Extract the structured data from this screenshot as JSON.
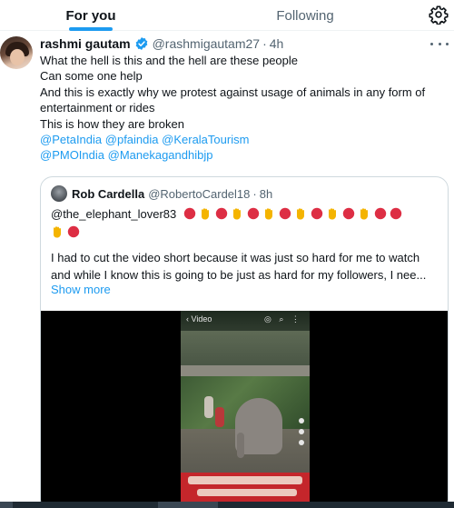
{
  "tabs": {
    "for_you": "For you",
    "following": "Following"
  },
  "tweet": {
    "display_name": "rashmi gautam",
    "handle": "@rashmigautam27",
    "separator": "·",
    "time": "4h",
    "lines": [
      "What the hell is this and the hell are these people",
      "Can some one help",
      "And this is exactly why we protest against usage of animals in any form of",
      "entertainment or rides",
      "This is how they are broken"
    ],
    "mentions_line1": [
      "@PetaIndia",
      "@pfaindia",
      "@KeralaTourism"
    ],
    "mentions_line2": [
      "@PMOIndia",
      "@Manekagandhibjp"
    ]
  },
  "quote": {
    "display_name": "Rob Cardella",
    "handle": "@RobertoCardel18",
    "separator": "·",
    "time": "8h",
    "mention": "@the_elephant_lover83",
    "emoji_line1": [
      "red-circle",
      "raised-hand",
      "red-circle",
      "raised-hand",
      "red-circle",
      "raised-hand",
      "red-circle",
      "raised-hand",
      "red-circle",
      "raised-hand",
      "red-circle",
      "raised-hand",
      "red-circle",
      "red-circle"
    ],
    "emoji_line2": [
      "raised-hand",
      "red-circle"
    ],
    "body": [
      "I had to cut the video short because it was just so hard for me to watch",
      "and while I know this is going to be just as hard for my followers, I nee..."
    ],
    "show_more": "Show more",
    "video": {
      "top_label": "‹  Video"
    }
  },
  "colors": {
    "accent": "#1d9bf0",
    "text": "#0f1419",
    "muted": "#536471",
    "border": "#cfd9de",
    "red_circle": "#dd2e44",
    "raised_hand": "#f4b400"
  }
}
